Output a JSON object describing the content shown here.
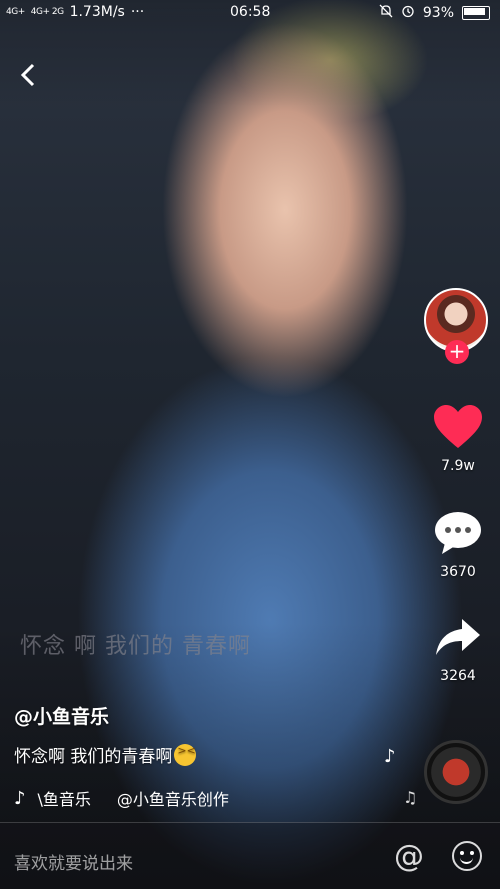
{
  "status_bar": {
    "network_1": "4G+",
    "network_2": "4G+ 2G",
    "speed": "1.73M/s",
    "dots": "···",
    "time": "06:58",
    "battery": "93%"
  },
  "actions": {
    "likes": "7.9w",
    "comments": "3670",
    "shares": "3264"
  },
  "video": {
    "lyric": "怀念 啊 我们的 青春啊",
    "username": "@小鱼音乐",
    "caption": "怀念啊 我们的青春啊",
    "music_scroll_1": "\\鱼音乐",
    "music_scroll_2": "@小鱼音乐创作"
  },
  "comment_bar": {
    "placeholder": "喜欢就要说出来",
    "at_symbol": "@"
  },
  "colors": {
    "like_red": "#fe2c55",
    "follow_red": "#fe2c55"
  }
}
